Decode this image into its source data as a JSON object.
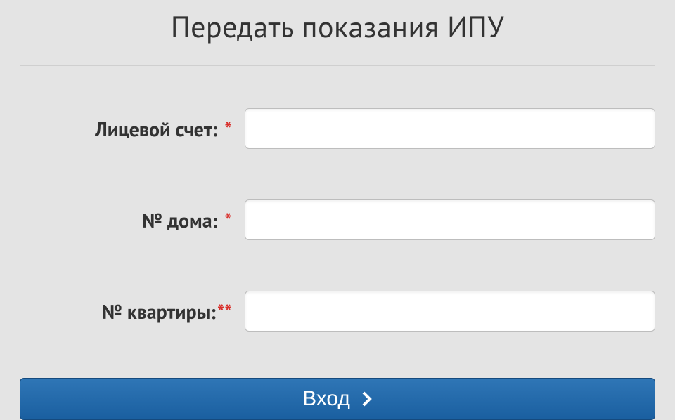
{
  "title": "Передать показания ИПУ",
  "fields": {
    "account": {
      "label": "Лицевой счет:",
      "required_mark": "*",
      "value": ""
    },
    "house": {
      "label": "№ дома:",
      "required_mark": "*",
      "value": ""
    },
    "apartment": {
      "label": "№ квартиры:",
      "required_mark": "**",
      "value": ""
    }
  },
  "submit": {
    "label": "Вход"
  }
}
